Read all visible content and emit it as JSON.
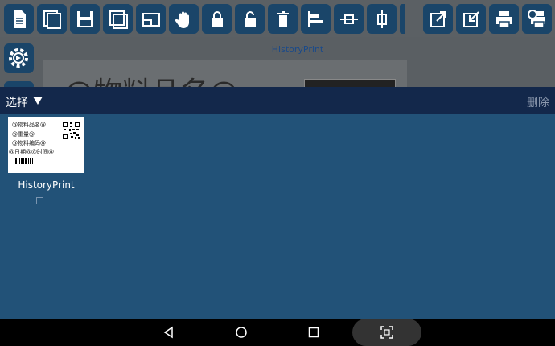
{
  "toolbar": {
    "icons": [
      "new-file-icon",
      "copy-icon",
      "save-icon",
      "duplicate-icon",
      "frame-icon",
      "hand-pan-icon",
      "lock-icon",
      "unlock-icon",
      "trash-icon",
      "align-left-icon",
      "align-center-horizontal-icon",
      "align-center-vertical-icon",
      "export-icon",
      "import-icon",
      "print-icon",
      "print-settings-icon"
    ]
  },
  "canvas": {
    "title": "HistoryPrint",
    "preview_text": "@物料品名@"
  },
  "dialog": {
    "select_label": "选择",
    "delete_label": "删除",
    "items": [
      {
        "name": "HistoryPrint",
        "thumbnail_lines": [
          "@物料品名@",
          "@重量@",
          "@物料编码@",
          "@日期@@时间@"
        ],
        "checked": false
      }
    ]
  },
  "navbar": {
    "buttons": [
      "back-icon",
      "home-icon",
      "recents-icon",
      "screenshot-icon"
    ]
  },
  "colors": {
    "header": "#13284b",
    "content": "#225278",
    "toolbar_button": "#1a4569"
  }
}
